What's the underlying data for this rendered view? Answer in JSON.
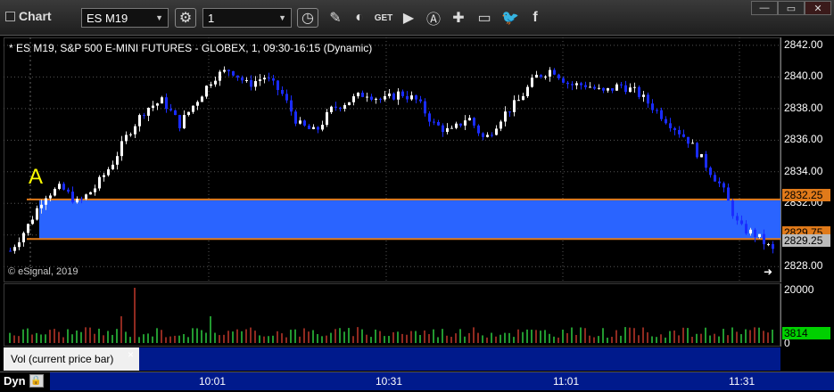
{
  "toolbar": {
    "app_title": "Chart",
    "symbol": "ES M19",
    "interval": "1",
    "icons": [
      "settings-gear-icon",
      "clock-icon",
      "pencil-icon",
      "study-icon",
      "get-icon",
      "play-icon",
      "alert-icon",
      "link-icon",
      "comment-icon",
      "twitter-icon",
      "facebook-icon"
    ],
    "window_buttons": [
      "minimize-icon",
      "restore-icon",
      "close-icon"
    ]
  },
  "chart": {
    "title": "* ES M19, S&P 500 E-MINI FUTURES - GLOBEX, 1, 09:30-16:15 (Dynamic)",
    "copyright": "© eSignal, 2019",
    "annotation": "A",
    "price_ticks": [
      "2842.00",
      "2840.00",
      "2838.00",
      "2836.00",
      "2834.00",
      "2832.00",
      "2830.00",
      "2828.00"
    ],
    "upper_band_tag": "2832.25",
    "lower_band_tag": "2829.75",
    "last_price_tag": "2829.25",
    "band_color": "#2a64ff",
    "band_line_color": "#e07a1a",
    "up_candle_color": "#ffffff",
    "down_candle_color": "#1a2cff"
  },
  "volume": {
    "label": "Vol (current price bar)",
    "close": "×",
    "ticks": [
      "20000",
      "0"
    ],
    "last_tag": "3814"
  },
  "time_axis": {
    "dyn_label": "Dyn",
    "ticks": [
      "10:01",
      "10:31",
      "11:01",
      "11:31"
    ]
  },
  "chart_data": {
    "type": "candlestick",
    "ylim": [
      2827,
      2842.5
    ],
    "price_ticks": [
      2842,
      2840,
      2838,
      2836,
      2834,
      2832,
      2830,
      2828
    ],
    "band": [
      2829.75,
      2832.25
    ],
    "x_ticks": [
      "10:01",
      "10:31",
      "11:01",
      "11:31"
    ],
    "close_path": [
      2829.0,
      2830.5,
      2832.5,
      2833.0,
      2832.0,
      2833.0,
      2834.5,
      2836.5,
      2838.0,
      2838.5,
      2837.0,
      2838.5,
      2840.0,
      2840.5,
      2839.5,
      2840.0,
      2839.0,
      2837.0,
      2836.5,
      2838.0,
      2838.5,
      2839.0,
      2838.5,
      2839.0,
      2838.5,
      2837.0,
      2836.5,
      2837.5,
      2836.0,
      2837.5,
      2838.5,
      2840.0,
      2840.5,
      2839.5,
      2839.5,
      2839.0,
      2839.5,
      2839.0,
      2838.0,
      2837.0,
      2836.0,
      2834.5,
      2833.0,
      2830.5,
      2830.0,
      2829.0
    ]
  }
}
